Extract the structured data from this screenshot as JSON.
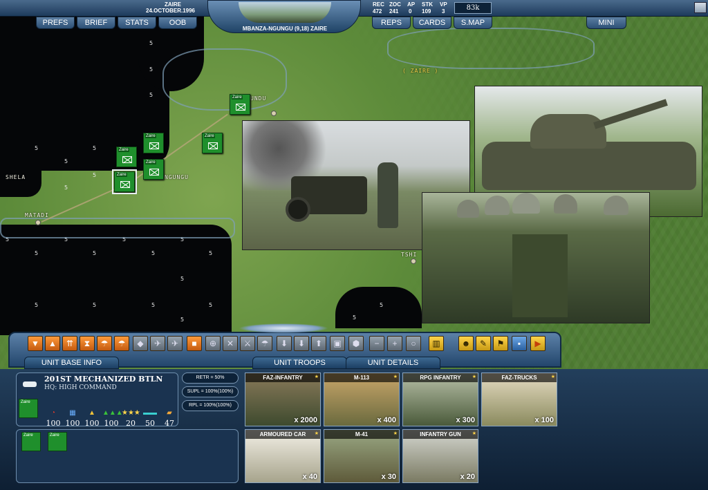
{
  "header": {
    "country": "ZAIRE",
    "date": "24.OCTOBER.1996",
    "location": "MBANZA-NGUNGU (9,18) ZAIRE",
    "money": "83k",
    "stats_labels": [
      "REC",
      "ZOC",
      "AP",
      "STK",
      "VP"
    ],
    "stats_values": [
      "472",
      "241",
      "0",
      "109",
      "3"
    ]
  },
  "nav": {
    "left": [
      "PREFS",
      "BRIEF",
      "STATS",
      "OOB"
    ],
    "right": [
      "REPS",
      "CARDS",
      "S.MAP"
    ],
    "mini": "MINI"
  },
  "map": {
    "region_label": "( ZAIRE )",
    "cities": [
      "UNDU",
      "SHELA",
      "MATADI",
      "NGUNGU",
      "TSHI"
    ],
    "hex_value": "5",
    "unit_tag": "Zaire"
  },
  "panel": {
    "tabs": [
      "UNIT BASE INFO",
      "UNIT TROOPS",
      "UNIT DETAILS"
    ],
    "unit": {
      "name": "201ST MECHANIZED BTLN",
      "hq": "HQ: HIGH COMMAND",
      "stat_values": [
        "100",
        "100",
        "100",
        "100",
        "20",
        "50",
        "47"
      ]
    },
    "pills": [
      "RETR = 50%",
      "SUPL = 100%(100%)",
      "RPL = 100%(100%)"
    ],
    "troops": [
      {
        "name": "FAZ-INFANTRY",
        "qty": "x 2000"
      },
      {
        "name": "M-113",
        "qty": "x 400"
      },
      {
        "name": "RPG INFANTRY",
        "qty": "x 300"
      },
      {
        "name": "FAZ-TRUCKS",
        "qty": "x 100"
      },
      {
        "name": "ARMOURED CAR",
        "qty": "x 40"
      },
      {
        "name": "M-41",
        "qty": "x 30"
      },
      {
        "name": "INFANTRY GUN",
        "qty": "x 20"
      }
    ]
  },
  "colors": {
    "unit_green": "#1f8f2c",
    "panel_blue": "#23466c",
    "tool_orange": "#e8761e"
  }
}
